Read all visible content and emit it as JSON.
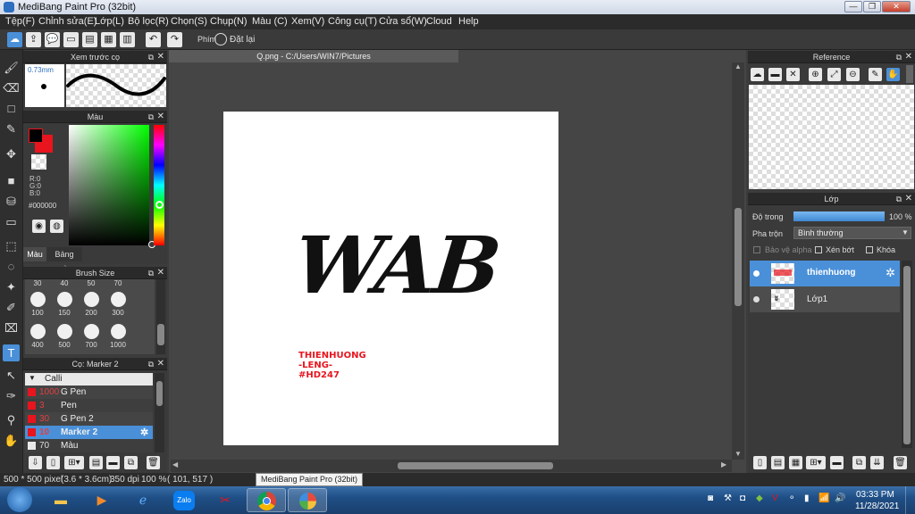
{
  "window": {
    "title": "MediBang Paint Pro (32bit)"
  },
  "menu": [
    "Tệp(F)",
    "Chỉnh sửa(E)",
    "Lớp(L)",
    "Bộ lọc(R)",
    "Chọn(S)",
    "Chụp(N)",
    "Màu (C)",
    "Xem(V)",
    "Công cụ(T)",
    "Cửa sổ(W)",
    "Cloud",
    "Help"
  ],
  "toolbar": {
    "key_label": "Phím",
    "reset_label": "Đặt lại"
  },
  "brush_preview": {
    "title": "Xem trước cọ",
    "size": "0.73mm"
  },
  "color_panel": {
    "title": "Màu",
    "r": "R:0",
    "g": "G:0",
    "b": "B:0",
    "hex": "#000000",
    "tab_color": "Màu",
    "tab_palette": "Bảng màu",
    "foreground": "#000000",
    "background": "#e8141e"
  },
  "brush_size": {
    "title": "Brush Size",
    "top_row": [
      "30",
      "40",
      "50",
      "70"
    ],
    "row1": [
      "100",
      "150",
      "200",
      "300"
    ],
    "row2": [
      "400",
      "500",
      "700",
      "1000"
    ]
  },
  "brush_list": {
    "title": "Cọ: Marker 2",
    "group": "Calli",
    "items": [
      {
        "size": "1000",
        "name": "G Pen",
        "color": "#e8141e"
      },
      {
        "size": "3",
        "name": "Pen",
        "color": "#e8141e"
      },
      {
        "size": "30",
        "name": "G Pen 2",
        "color": "#e8141e"
      },
      {
        "size": "10",
        "name": "Marker 2",
        "color": "#e8141e",
        "selected": true
      },
      {
        "size": "70",
        "name": "Màu",
        "color": "#e9e9e9"
      }
    ]
  },
  "canvas": {
    "tab": "Q.png - C:/Users/WIN7/Pictures",
    "artwork_text": "WAB",
    "signature": [
      "THIENHUONG",
      "-LENG-",
      "#HD247"
    ]
  },
  "reference": {
    "title": "Reference"
  },
  "layers": {
    "title": "Lớp",
    "opacity_label": "Độ trong",
    "opacity_value": "100 %",
    "opacity_fraction": 1.0,
    "blend_label": "Pha trộn",
    "blend_value": "Bình thường",
    "protect_alpha": "Bảo vệ alpha",
    "clipping": "Xén bớt",
    "lock": "Khóa",
    "items": [
      {
        "name": "thienhuong",
        "selected": true
      },
      {
        "name": "Lớp1",
        "selected": false
      }
    ]
  },
  "status": {
    "dims": "500 * 500 pixel",
    "physical": "(3.6 * 3.6cm)",
    "dpi": "350 dpi",
    "zoom": "100 %",
    "coords": "( 101, 517 )"
  },
  "taskbar": {
    "tooltip": "MediBang Paint Pro (32bit)",
    "apps": [
      "windows-start",
      "file-explorer",
      "media-player",
      "internet-explorer",
      "zalo",
      "snipping-tool",
      "chrome",
      "medibang-paint"
    ],
    "zalo_label": "Zalo",
    "time": "03:33 PM",
    "date": "11/28/2021"
  }
}
